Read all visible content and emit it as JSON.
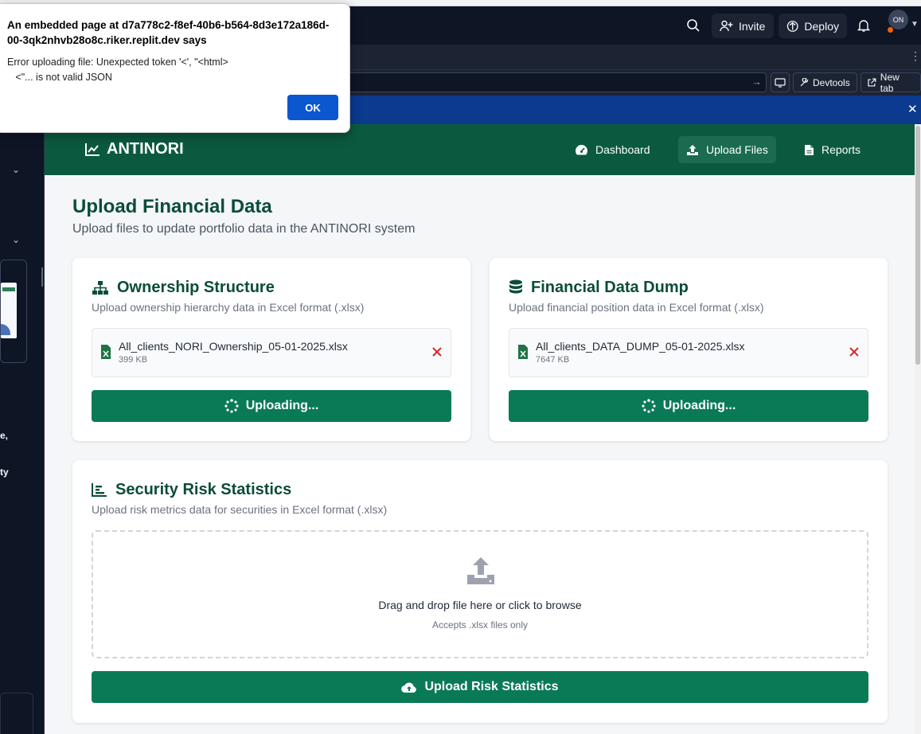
{
  "dialog": {
    "title": "An embedded page at d7a778c2-f8ef-40b6-b564-8d3e172a186d-00-3qk2nhvb28o8c.riker.replit.dev says",
    "message": "Error uploading file: Unexpected token '<', \"<html>\n   <\"... is not valid JSON",
    "ok_label": "OK"
  },
  "replit": {
    "invite_label": "Invite",
    "deploy_label": "Deploy",
    "avatar_initials": "ON",
    "devtools_label": "Devtools",
    "new_tab_label": "New tab"
  },
  "sidebar": {
    "fragments": [
      "e,",
      "ty"
    ]
  },
  "app": {
    "brand": "ANTINORI",
    "nav": [
      {
        "label": "Dashboard",
        "icon": "gauge-icon"
      },
      {
        "label": "Upload Files",
        "icon": "upload-icon",
        "active": true
      },
      {
        "label": "Reports",
        "icon": "file-icon"
      }
    ],
    "page_title": "Upload Financial Data",
    "page_subtitle": "Upload files to update portfolio data in the ANTINORI system",
    "ownership": {
      "title": "Ownership Structure",
      "subtitle": "Upload ownership hierarchy data in Excel format (.xlsx)",
      "file_name": "All_clients_NORI_Ownership_05-01-2025.xlsx",
      "file_size": "399 KB",
      "button_label": "Uploading..."
    },
    "financial": {
      "title": "Financial Data Dump",
      "subtitle": "Upload financial position data in Excel format (.xlsx)",
      "file_name": "All_clients_DATA_DUMP_05-01-2025.xlsx",
      "file_size": "7647 KB",
      "button_label": "Uploading..."
    },
    "risk": {
      "title": "Security Risk Statistics",
      "subtitle": "Upload risk metrics data for securities in Excel format (.xlsx)",
      "dropzone_text": "Drag and drop file here or click to browse",
      "dropzone_subtext": "Accepts .xlsx files only",
      "button_label": "Upload Risk Statistics"
    }
  },
  "colors": {
    "brand_green": "#0b5a40",
    "button_green": "#0a7a56",
    "title_green": "#0b4d36",
    "remove_red": "#dc2626",
    "ok_blue": "#0b57d0"
  }
}
